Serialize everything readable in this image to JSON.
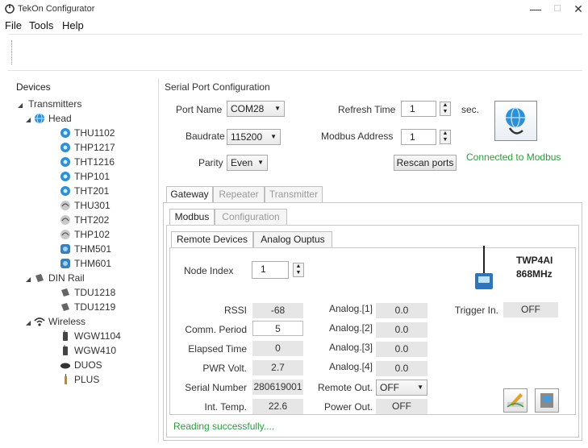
{
  "window": {
    "title": "TekOn Configurator",
    "minimize": "—",
    "maximize": "☐",
    "close": "✕"
  },
  "menu": [
    "File",
    "Tools",
    "Help"
  ],
  "devices": {
    "title": "Devices",
    "transmitters": "Transmitters",
    "head": "Head",
    "head_items": [
      "THU1102",
      "THP1217",
      "THT1216",
      "THP101",
      "THT201",
      "THU301",
      "THT202",
      "THP102",
      "THM501",
      "THM601"
    ],
    "din_rail": "DIN Rail",
    "din_items": [
      "TDU1218",
      "TDU1219"
    ],
    "wireless": "Wireless",
    "wireless_items": [
      "WGW1104",
      "WGW410",
      "DUOS",
      "PLUS"
    ]
  },
  "serial": {
    "title": "Serial Port Configuration",
    "port_label": "Port Name",
    "port_value": "COM28",
    "baud_label": "Baudrate",
    "baud_value": "115200",
    "parity_label": "Parity",
    "parity_value": "Even",
    "refresh_label": "Refresh Time",
    "refresh_value": "1",
    "refresh_unit": "sec.",
    "modbus_label": "Modbus Address",
    "modbus_value": "1",
    "rescan_label": "Rescan ports",
    "status": "Connected to Modbus"
  },
  "tabs": {
    "main": [
      "Gateway",
      "Repeater",
      "Transmitter"
    ],
    "sub": [
      "Modbus",
      "Configuration"
    ],
    "inner": [
      "Remote Devices",
      "Analog Ouptus"
    ]
  },
  "remote": {
    "node_label": "Node Index",
    "node_value": "1",
    "device_name": "TWP4AI",
    "device_freq": "868MHz",
    "rssi_label": "RSSI",
    "rssi": "-68",
    "comm_label": "Comm. Period",
    "comm": "5",
    "elapsed_label": "Elapsed Time",
    "elapsed": "0",
    "pwr_label": "PWR Volt.",
    "pwr": "2.7",
    "serial_label": "Serial Number",
    "serial": "280619001",
    "temp_label": "Int. Temp.",
    "temp": "22.6",
    "a1_label": "Analog.[1]",
    "a1": "0.0",
    "a2_label": "Analog.[2]",
    "a2": "0.0",
    "a3_label": "Analog.[3]",
    "a3": "0.0",
    "a4_label": "Analog.[4]",
    "a4": "0.0",
    "rout_label": "Remote Out.",
    "rout": "OFF",
    "pout_label": "Power Out.",
    "pout": "OFF",
    "trig_label": "Trigger In.",
    "trig": "OFF"
  },
  "status_text": "Reading successfully....",
  "colors": {
    "accent": "#2e8fd6",
    "status_green": "#2f9a3c"
  }
}
